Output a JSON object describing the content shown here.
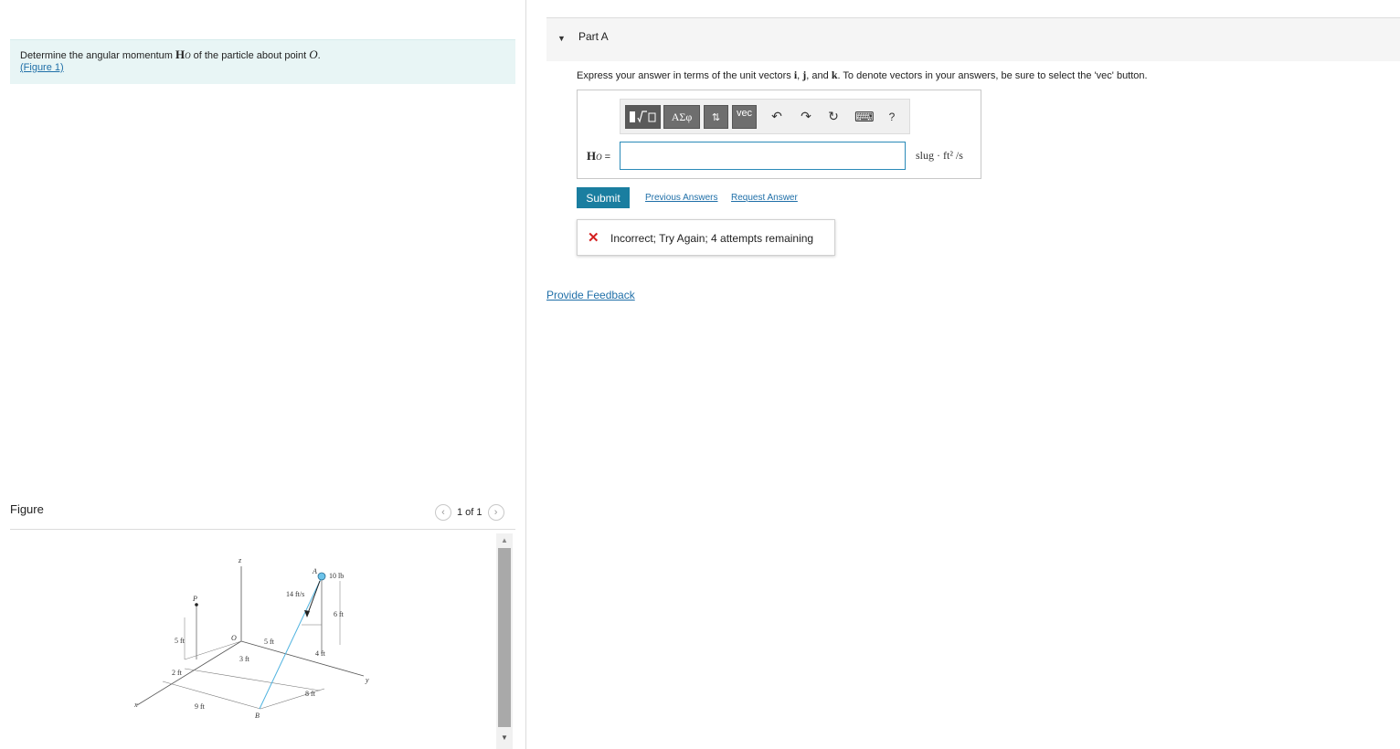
{
  "problem": {
    "text_before": "Determine the angular momentum ",
    "h_symbol": "H",
    "h_subscript": "O",
    "text_after": " of the particle about point ",
    "point": "O",
    "period": ".",
    "figure_link": "(Figure 1)"
  },
  "figure_panel": {
    "title": "Figure",
    "page_indicator": "1 of 1",
    "labels": {
      "z": "z",
      "A": "A",
      "force": "10 lb",
      "velocity": "14 ft/s",
      "P": "P",
      "d6": "6 ft",
      "O": "O",
      "d5a": "5 ft",
      "d5b": "5 ft",
      "d4": "4 ft",
      "d3": "3 ft",
      "d2": "2 ft",
      "y": "y",
      "d8": "8 ft",
      "x": "x",
      "d9": "9 ft",
      "B": "B"
    }
  },
  "part": {
    "title": "Part A",
    "instructions": {
      "t1": "Express your answer in terms of the unit vectors ",
      "i": "i",
      "c1": ", ",
      "j": "j",
      "c2": ", and ",
      "k": "k",
      "t2": ". To denote vectors in your answers, be sure to select the 'vec' button."
    },
    "toolbar": {
      "greek": "ΑΣφ",
      "arrows": "⇅",
      "vec": "vec",
      "undo": "↶",
      "redo": "↷",
      "reset": "↻",
      "keyboard": "⌨",
      "help": "?"
    },
    "answer_label": "H",
    "answer_subscript": "O",
    "answer_equals": " =",
    "answer_value": "",
    "units": "slug · ft² /s",
    "submit_label": "Submit",
    "previous_answers": "Previous Answers",
    "request_answer": "Request Answer",
    "feedback_icon": "✕",
    "feedback": "Incorrect; Try Again; 4 attempts remaining"
  },
  "provide_feedback": "Provide Feedback"
}
